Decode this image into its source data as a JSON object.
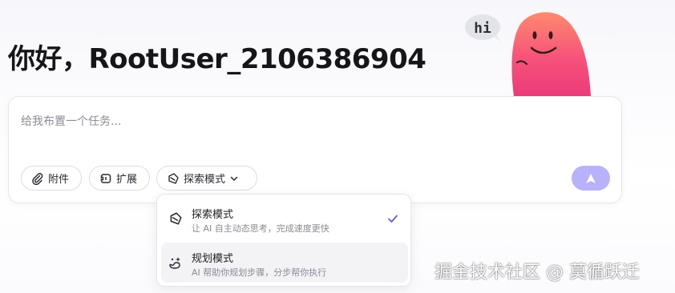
{
  "greeting": "你好，RootUser_2106386904",
  "mascot": {
    "speech": "hi"
  },
  "composer": {
    "placeholder": "给我布置一个任务...",
    "attach_label": "附件",
    "extend_label": "扩展",
    "mode_label": "探索模式"
  },
  "mode_menu": {
    "options": [
      {
        "title": "探索模式",
        "desc": "让 AI 自主动态思考，完成速度更快",
        "selected": true
      },
      {
        "title": "规划模式",
        "desc": "AI 帮助你规划步骤，分步帮你执行",
        "selected": false
      }
    ]
  },
  "watermark": "掘金技术社区 @ 莫循跃迁",
  "colors": {
    "accent": "#6a5ae0",
    "send_bg": "#b7b2fb",
    "mascot_pink": "#f0477a"
  },
  "icons": [
    "paperclip-icon",
    "extension-icon",
    "explore-mode-icon",
    "chevron-down-icon",
    "send-arrow-icon",
    "check-icon",
    "plan-mode-icon"
  ]
}
